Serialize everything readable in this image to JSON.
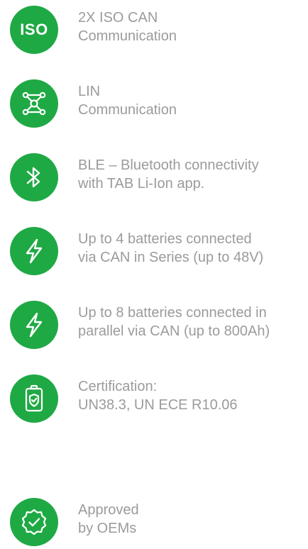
{
  "accent_color": "#1fa944",
  "text_color": "#9b9b9b",
  "features": [
    {
      "icon": "iso-badge-icon",
      "icon_text": "ISO",
      "line1": "2X ISO CAN",
      "line2": "Communication"
    },
    {
      "icon": "network-nodes-icon",
      "line1": "LIN",
      "line2": "Communication"
    },
    {
      "icon": "bluetooth-icon",
      "line1": "BLE – Bluetooth connectivity",
      "line2": "with TAB Li-Ion app."
    },
    {
      "icon": "lightning-bolt-icon",
      "line1": "Up to 4 batteries connected",
      "line2": "via CAN in Series (up to 48V)"
    },
    {
      "icon": "lightning-bolt-icon",
      "line1": "Up to 8 batteries connected in",
      "line2": "parallel via CAN (up to 800Ah)"
    },
    {
      "icon": "battery-shield-icon",
      "line1": "Certification:",
      "line2": "UN38.3, UN ECE R10.06"
    },
    {
      "icon": "verified-seal-icon",
      "line1": "Approved",
      "line2": "by OEMs"
    }
  ]
}
